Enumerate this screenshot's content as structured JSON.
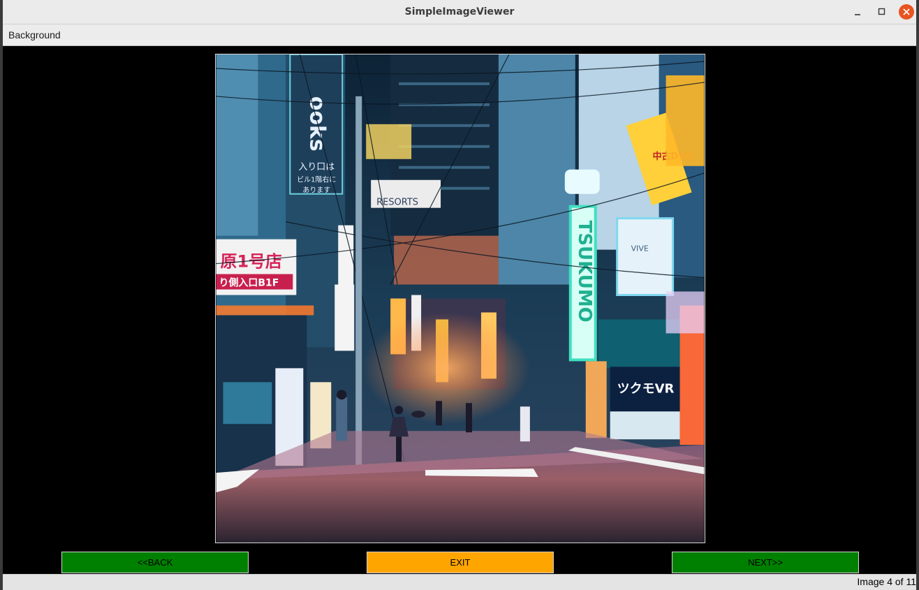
{
  "window": {
    "title": "SimpleImageViewer"
  },
  "window_controls": {
    "minimize_icon": "minimize-icon",
    "maximize_icon": "maximize-icon",
    "close_icon": "close-icon"
  },
  "menu": {
    "items": [
      {
        "label": "Background"
      }
    ]
  },
  "image": {
    "description_icon": "photo",
    "sign_texts": [
      "ooks",
      "入り口は",
      "ビル1階右に",
      "あります",
      "原1号店",
      "り側入口B1F",
      "RESORTS",
      "TSUKUMO",
      "ツクモVR",
      "VIVE",
      "中古DVD"
    ]
  },
  "buttons": {
    "back": "<<BACK",
    "exit": "EXIT",
    "next": "NEXT>>"
  },
  "status": {
    "text": "Image 4 of 11"
  },
  "colors": {
    "back": "#008000",
    "exit": "#ffa500",
    "next": "#008000",
    "close": "#e95420"
  }
}
